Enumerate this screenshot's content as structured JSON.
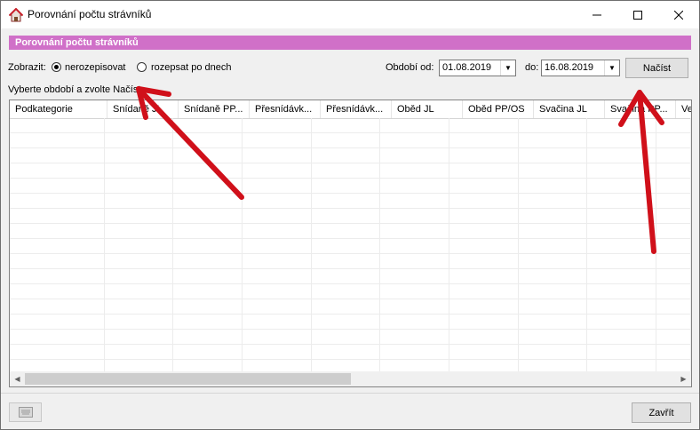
{
  "window": {
    "title": "Porovnání počtu strávníků",
    "icon": "app-home-icon"
  },
  "titlebar": {
    "minimize": "—",
    "maximize": "☐",
    "close": "✕"
  },
  "header": {
    "title": "Porovnání počtu strávníků",
    "color": "#d070c8"
  },
  "display": {
    "label": "Zobrazit:",
    "options": [
      {
        "label": "nerozepisovat",
        "checked": true
      },
      {
        "label": "rozepsat po dnech",
        "checked": false
      }
    ]
  },
  "period": {
    "from_label": "Období od:",
    "from_value": "01.08.2019",
    "to_label": "do:",
    "to_value": "16.08.2019",
    "load_button": "Načíst"
  },
  "hint": "Vyberte období a zvolte Načíst",
  "table": {
    "columns": [
      "Podkategorie",
      "Snídaně JL",
      "Snídaně PP...",
      "Přesnídávk...",
      "Přesnídávk...",
      "Oběd JL",
      "Oběd PP/OS",
      "Svačina JL",
      "Svačina PP...",
      "Ve"
    ]
  },
  "footer": {
    "close_button": "Zavřít",
    "left_button_icon": "keyboard-icon"
  },
  "annotations": {
    "arrow_color": "#d0101a"
  }
}
